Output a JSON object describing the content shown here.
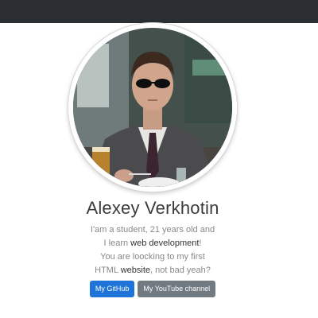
{
  "profile": {
    "name": "Alexey Verkhotin",
    "bio": {
      "line1": "I'am a student, 21 years old and",
      "line2_prefix": "I learn ",
      "line2_highlight": "web development",
      "line2_suffix": "!",
      "line3": "You are loocking to my first",
      "line4_prefix": "HTML ",
      "line4_highlight": "website",
      "line4_suffix": ", not bad yeah?"
    }
  },
  "buttons": {
    "github": "My GitHub",
    "youtube": "My YouTube channel"
  },
  "colors": {
    "navbar": "#2b2f33",
    "primary": "#1e74d8",
    "secondary": "#727a81"
  }
}
